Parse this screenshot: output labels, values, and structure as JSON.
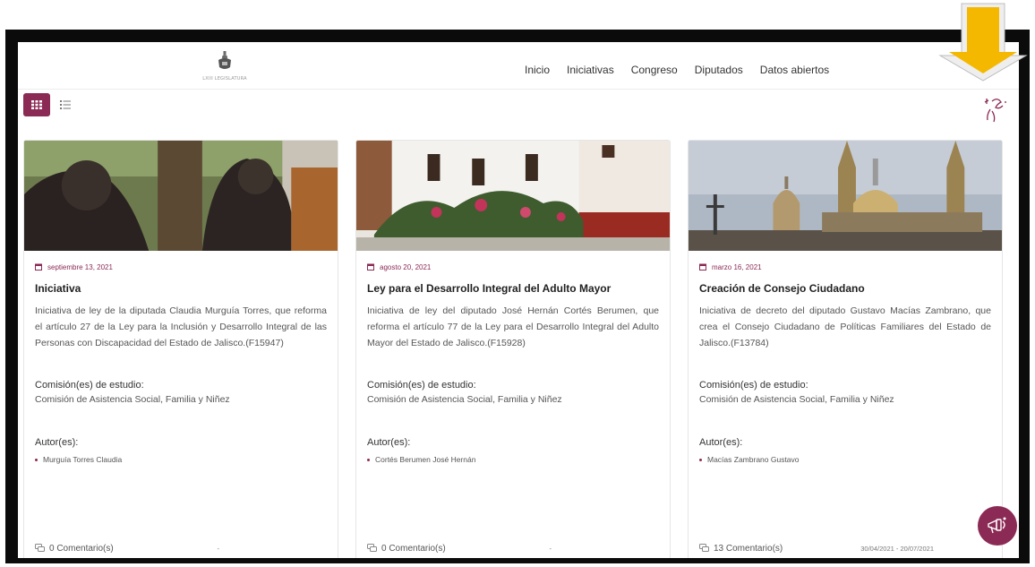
{
  "nav": {
    "logo_text": "LXIII LEGISLATURA",
    "links": [
      "Inicio",
      "Iniciativas",
      "Congreso",
      "Diputados",
      "Datos abiertos"
    ]
  },
  "labels": {
    "comisiones": "Comisión(es) de estudio:",
    "autores": "Autor(es):"
  },
  "cards": [
    {
      "date": "septiembre 13, 2021",
      "title": "Iniciativa",
      "description": "Iniciativa de ley de la diputada Claudia Murguía Torres, que reforma el artículo 27 de la Ley para la Inclusión y Desarrollo Integral de las Personas con Discapacidad del Estado de Jalisco.(F15947)",
      "commission": "Comisión de Asistencia Social, Familia y Niñez",
      "author": "Murguía Torres Claudia",
      "comments": "0 Comentario(s)",
      "range": "-"
    },
    {
      "date": "agosto 20, 2021",
      "title": "Ley para el Desarrollo Integral del Adulto Mayor",
      "description": "Iniciativa de ley del diputado José Hernán Cortés Berumen, que reforma el artículo 77 de la Ley para el Desarrollo Integral del Adulto Mayor del Estado de Jalisco.(F15928)",
      "commission": "Comisión de Asistencia Social, Familia y Niñez",
      "author": "Cortés Berumen José Hernán",
      "comments": "0 Comentario(s)",
      "range": "-"
    },
    {
      "date": "marzo 16, 2021",
      "title": "Creación de Consejo Ciudadano",
      "description": "Iniciativa de decreto del diputado Gustavo Macías Zambrano, que crea el Consejo Ciudadano de Políticas Familiares del Estado de Jalisco.(F13784)",
      "commission": "Comisión de Asistencia Social, Familia y Niñez",
      "author": "Macías Zambrano Gustavo",
      "comments": "13 Comentario(s)",
      "range": "30/04/2021 - 20/07/2021"
    }
  ],
  "colors": {
    "accent": "#8b2a55",
    "arrow": "#f5b800"
  },
  "icons": {
    "grid_view": "grid-icon",
    "list_view": "list-icon",
    "accessibility": "accessibility-icon",
    "date": "calendar-icon",
    "comments": "comment-icon",
    "fab": "megaphone-icon"
  }
}
